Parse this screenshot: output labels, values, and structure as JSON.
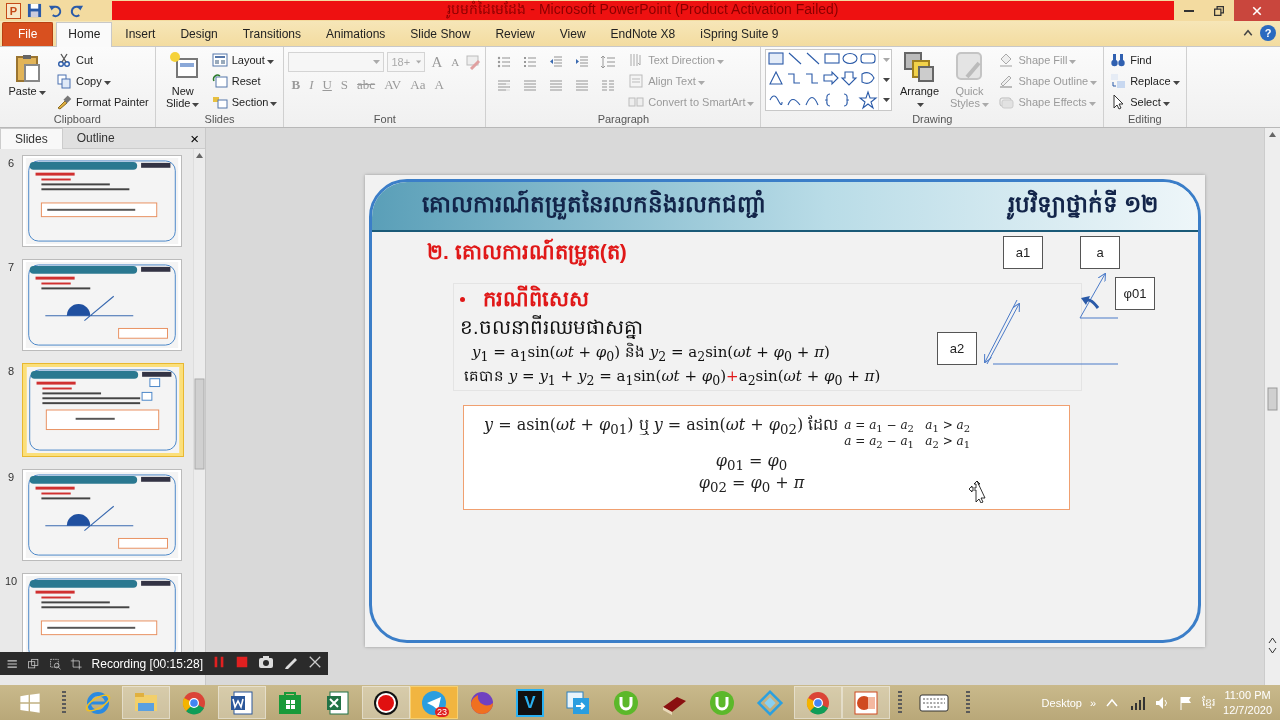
{
  "window": {
    "logo": "P",
    "title": "រូបមកំដៃមេដែង - Microsoft PowerPoint (Product Activation Failed)",
    "help": "?"
  },
  "tabs": [
    {
      "label": "File",
      "kind": "file",
      "selected": false
    },
    {
      "label": "Home",
      "kind": "tab",
      "selected": true
    },
    {
      "label": "Insert",
      "kind": "tab",
      "selected": false
    },
    {
      "label": "Design",
      "kind": "tab",
      "selected": false
    },
    {
      "label": "Transitions",
      "kind": "tab",
      "selected": false
    },
    {
      "label": "Animations",
      "kind": "tab",
      "selected": false
    },
    {
      "label": "Slide Show",
      "kind": "tab",
      "selected": false
    },
    {
      "label": "Review",
      "kind": "tab",
      "selected": false
    },
    {
      "label": "View",
      "kind": "tab",
      "selected": false
    },
    {
      "label": "EndNote X8",
      "kind": "tab",
      "selected": false
    },
    {
      "label": "iSpring Suite 9",
      "kind": "tab",
      "selected": false
    }
  ],
  "ribbon": [
    {
      "label": "Clipboard",
      "kind": "standard",
      "large": [
        {
          "label": "Paste",
          "dropdown": true,
          "disabled": false
        }
      ],
      "small": [
        {
          "label": "Cut",
          "dropdown": false,
          "disabled": false
        },
        {
          "label": "Copy",
          "dropdown": true,
          "disabled": false
        },
        {
          "label": "Format Painter",
          "dropdown": false,
          "disabled": false
        }
      ]
    },
    {
      "label": "Slides",
      "kind": "standard",
      "large": [
        {
          "label": "New Slide",
          "dropdown": true,
          "disabled": false
        }
      ],
      "small": [
        {
          "label": "Layout",
          "dropdown": true,
          "disabled": false
        },
        {
          "label": "Reset",
          "dropdown": false,
          "disabled": false
        },
        {
          "label": "Section",
          "dropdown": true,
          "disabled": false
        }
      ]
    },
    {
      "label": "Font",
      "kind": "font",
      "font_size": "18+",
      "top_buttons": [
        {
          "label": "A",
          "disabled": true
        },
        {
          "label": "A",
          "disabled": true
        }
      ],
      "buttons": [
        {
          "label": "B",
          "disabled": true
        },
        {
          "label": "I",
          "disabled": true
        },
        {
          "label": "U",
          "disabled": true
        },
        {
          "label": "S",
          "disabled": true
        },
        {
          "label": "abc",
          "disabled": true
        },
        {
          "label": "AV",
          "disabled": true
        },
        {
          "label": "Aa",
          "disabled": true
        },
        {
          "label": "A",
          "disabled": true
        }
      ]
    },
    {
      "label": "Paragraph",
      "kind": "paragraph",
      "small": [
        {
          "label": "Text Direction",
          "dropdown": true,
          "disabled": true
        },
        {
          "label": "Align Text",
          "dropdown": true,
          "disabled": true
        },
        {
          "label": "Convert to SmartArt",
          "dropdown": true,
          "disabled": true
        }
      ]
    },
    {
      "label": "Drawing",
      "kind": "drawing",
      "large": [
        {
          "label": "Arrange",
          "dropdown": true,
          "disabled": false
        },
        {
          "label": "Quick Styles",
          "dropdown": true,
          "disabled": true
        }
      ],
      "small": [
        {
          "label": "Shape Fill",
          "dropdown": true,
          "disabled": true
        },
        {
          "label": "Shape Outline",
          "dropdown": true,
          "disabled": true
        },
        {
          "label": "Shape Effects",
          "dropdown": true,
          "disabled": true
        }
      ]
    },
    {
      "label": "Editing",
      "kind": "standard",
      "small": [
        {
          "label": "Find",
          "dropdown": false,
          "disabled": false
        },
        {
          "label": "Replace",
          "dropdown": true,
          "disabled": false
        },
        {
          "label": "Select",
          "dropdown": true,
          "disabled": false
        }
      ]
    }
  ],
  "panel": {
    "tabs": [
      {
        "label": "Slides",
        "selected": true
      },
      {
        "label": "Outline",
        "selected": false
      }
    ],
    "close": "×",
    "thumbnails": [
      {
        "number": "6",
        "kind": "text",
        "selected": false
      },
      {
        "number": "7",
        "kind": "diagram",
        "selected": false
      },
      {
        "number": "8",
        "kind": "boxed",
        "selected": true
      },
      {
        "number": "9",
        "kind": "diagram",
        "selected": false
      },
      {
        "number": "10",
        "kind": "text",
        "selected": false
      }
    ]
  },
  "slide": {
    "title": "គោលការណ៍តម្រួតនៃរលកនិងរលកជញ្ជាំ",
    "subject": "រូបវិទ្យាថ្នាក់ទី ១២",
    "heading": "២. គោលការណ៍តម្រួត(ត)",
    "bullet": "ករណីពិសេស",
    "case": "ខ.ចលនាពីរឈមផាសគ្នា",
    "equation": "*y*$_{1}$ = a$_{1}$sin(*ωt* + *φ*$_{0}$) និង *y*$_{2}$ = a$_{2}$sin(*ωt* + *φ*$_{0}$ + *π*)",
    "result": {
      "before": "គេបាន *y* = *y*$_{1}$ + *y*$_{2}$ = a$_{1}$sin(*ωt* + *φ*$_{0}$)",
      "accent": "+",
      "after": "a$_{2}$sin(*ωt* + *φ*$_{0}$ + *π*)"
    },
    "box": {
      "main": "*y* = asin(*ωt* + *φ*$_{01}$) ឬ *y* = asin(*ωt* + *φ*$_{02}$) ដែល",
      "conditions": [
        "*a* = *a*$_{1}$ − *a*$_{2}$   *a*$_{1}$ > *a*$_{2}$",
        "*a* = *a*$_{2}$ − *a*$_{1}$   *a*$_{2}$ > *a*$_{1}$"
      ],
      "phases": [
        "*φ*$_{01}$ = *φ*$_{0}$",
        "*φ*$_{02}$ = *φ*$_{0}$ + *π*"
      ]
    },
    "diagram_labels": [
      "a1",
      "a",
      "φ01",
      "a2"
    ]
  },
  "recorder": {
    "status": "Recording [00:15:28]"
  },
  "taskbar": {
    "apps": [
      {
        "kind": "ie",
        "running": false,
        "attention": false
      },
      {
        "kind": "folder",
        "running": true,
        "attention": false
      },
      {
        "kind": "chrome",
        "running": false,
        "attention": false
      },
      {
        "kind": "word",
        "running": true,
        "attention": false
      },
      {
        "kind": "store",
        "running": false,
        "attention": false
      },
      {
        "kind": "excel",
        "running": false,
        "attention": false
      },
      {
        "kind": "record",
        "running": true,
        "attention": false
      },
      {
        "kind": "telegram",
        "running": true,
        "attention": true,
        "badge": "23"
      },
      {
        "kind": "firefox",
        "running": false,
        "attention": false
      },
      {
        "kind": "v",
        "running": false,
        "attention": false,
        "letter": "V"
      },
      {
        "kind": "arrow",
        "running": false,
        "attention": false
      },
      {
        "kind": "torrent",
        "running": false,
        "attention": false
      },
      {
        "kind": "book",
        "running": false,
        "attention": false
      },
      {
        "kind": "torrent",
        "running": false,
        "attention": false
      },
      {
        "kind": "diamond",
        "running": false,
        "attention": false
      },
      {
        "kind": "chrome",
        "running": true,
        "attention": false
      },
      {
        "kind": "powerpoint",
        "running": true,
        "attention": false
      }
    ],
    "desktop": "Desktop",
    "more": "»",
    "language": "ខ្មែរ",
    "time": "11:00 PM",
    "date": "12/7/2020"
  }
}
